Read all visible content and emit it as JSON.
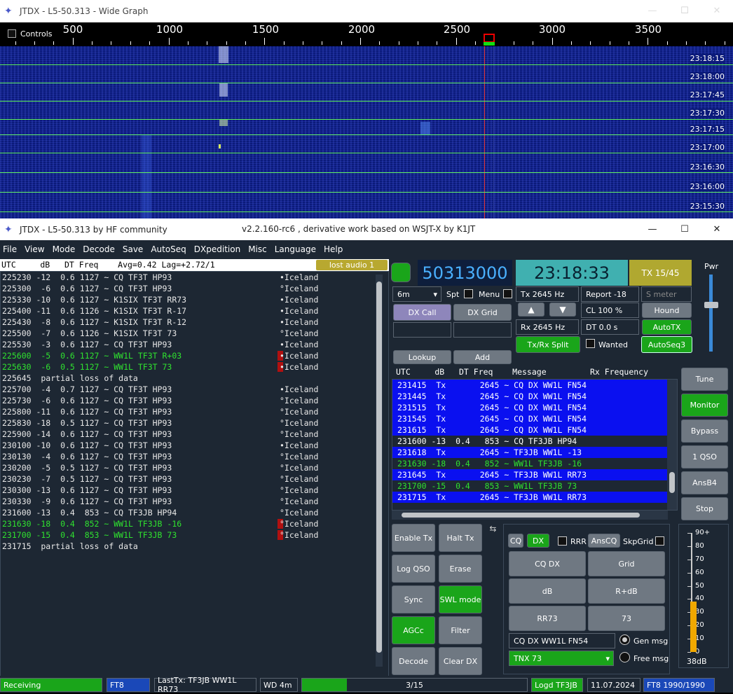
{
  "wide_graph": {
    "title": "JTDX - L5-50.313 - Wide Graph",
    "controls_label": "Controls",
    "scale_labels": [
      "500",
      "1000",
      "1500",
      "2000",
      "2500",
      "3000",
      "3500"
    ],
    "times": [
      "23:18:15",
      "23:18:00",
      "23:17:45",
      "23:17:30",
      "23:17:15",
      "23:17:00",
      "23:16:30",
      "23:16:00",
      "23:15:30"
    ],
    "band": "6m"
  },
  "main": {
    "title": "JTDX - L5-50.313  by HF community",
    "subtitle": "v2.2.160-rc6 , derivative work based on WSJT-X by K1JT",
    "menu": [
      "File",
      "View",
      "Mode",
      "Decode",
      "Save",
      "AutoSeq",
      "DXpedition",
      "Misc",
      "Language",
      "Help"
    ],
    "left_header": "UTC     dB   DT Freq    Avg=0.42 Lag=+2.72/1",
    "lost_audio": "lost audio 1",
    "decodes": [
      {
        "t": "225230 -12  0.6 1127 ~ CQ TF3T HP93",
        "c": "•Iceland",
        "g": false,
        "m": false
      },
      {
        "t": "225300  -6  0.6 1127 ~ CQ TF3T HP93",
        "c": "°Iceland",
        "g": false,
        "m": false
      },
      {
        "t": "225330 -10  0.6 1127 ~ K1SIX TF3T RR73",
        "c": "•Iceland",
        "g": false,
        "m": false
      },
      {
        "t": "225400 -11  0.6 1126 ~ K1SIX TF3T R-17",
        "c": "•Iceland",
        "g": false,
        "m": false
      },
      {
        "t": "225430  -8  0.6 1127 ~ K1SIX TF3T R-12",
        "c": "•Iceland",
        "g": false,
        "m": false
      },
      {
        "t": "225500  -7  0.6 1126 ~ K1SIX TF3T 73",
        "c": "°Iceland",
        "g": false,
        "m": false
      },
      {
        "t": "225530  -3  0.6 1127 ~ CQ TF3T HP93",
        "c": "•Iceland",
        "g": false,
        "m": false
      },
      {
        "t": "225600  -5  0.6 1127 ~ WW1L TF3T R+03",
        "c": "•Iceland",
        "g": true,
        "m": true
      },
      {
        "t": "225630  -6  0.5 1127 ~ WW1L TF3T 73",
        "c": "•Iceland",
        "g": true,
        "m": true
      },
      {
        "t": "225645  partial loss of data",
        "c": "",
        "g": false,
        "m": false
      },
      {
        "t": "225700  -4  0.7 1127 ~ CQ TF3T HP93",
        "c": "•Iceland",
        "g": false,
        "m": false
      },
      {
        "t": "225730  -6  0.6 1127 ~ CQ TF3T HP93",
        "c": "°Iceland",
        "g": false,
        "m": false
      },
      {
        "t": "225800 -11  0.6 1127 ~ CQ TF3T HP93",
        "c": "°Iceland",
        "g": false,
        "m": false
      },
      {
        "t": "225830 -18  0.5 1127 ~ CQ TF3T HP93",
        "c": "°Iceland",
        "g": false,
        "m": false
      },
      {
        "t": "225900 -14  0.6 1127 ~ CQ TF3T HP93",
        "c": "°Iceland",
        "g": false,
        "m": false
      },
      {
        "t": "230100 -10  0.6 1127 ~ CQ TF3T HP93",
        "c": "•Iceland",
        "g": false,
        "m": false
      },
      {
        "t": "230130  -4  0.6 1127 ~ CQ TF3T HP93",
        "c": "°Iceland",
        "g": false,
        "m": false
      },
      {
        "t": "230200  -5  0.5 1127 ~ CQ TF3T HP93",
        "c": "°Iceland",
        "g": false,
        "m": false
      },
      {
        "t": "230230  -7  0.5 1127 ~ CQ TF3T HP93",
        "c": "°Iceland",
        "g": false,
        "m": false
      },
      {
        "t": "230300 -13  0.6 1127 ~ CQ TF3T HP93",
        "c": "°Iceland",
        "g": false,
        "m": false
      },
      {
        "t": "230330  -9  0.6 1127 ~ CQ TF3T HP93",
        "c": "°Iceland",
        "g": false,
        "m": false
      },
      {
        "t": "231600 -13  0.4  853 ~ CQ TF3JB HP94",
        "c": "°Iceland",
        "g": false,
        "m": false
      },
      {
        "t": "231630 -18  0.4  852 ~ WW1L TF3JB -16",
        "c": "°Iceland",
        "g": true,
        "m": true
      },
      {
        "t": "231700 -15  0.4  853 ~ WW1L TF3JB 73",
        "c": "°Iceland",
        "g": true,
        "m": true
      },
      {
        "t": "231715  partial loss of data",
        "c": "",
        "g": false,
        "m": false
      }
    ],
    "dial_freq": "50313000",
    "clock": "23:18:33",
    "tx_phase": "TX 15/45",
    "pwr_label": "Pwr",
    "band_select": "6m",
    "spt": "Spt",
    "menu_chk": "Menu",
    "tx_freq": "Tx  2645 Hz",
    "rx_freq": "Rx  2645 Hz",
    "report": "Report -18",
    "smeter": "S meter",
    "cl": "CL  100 %",
    "dt": "DT 0.0 s",
    "buttons": {
      "dx_call": "DX Call",
      "dx_grid": "DX Grid",
      "lookup": "Lookup",
      "add": "Add",
      "hound": "Hound",
      "autotx": "AutoTX",
      "txrx_split": "Tx/Rx Split",
      "wanted": "Wanted",
      "autoseq3": "AutoSeq3",
      "tune": "Tune",
      "monitor": "Monitor",
      "bypass": "Bypass",
      "one_qso": "1 QSO",
      "ansb4": "AnsB4",
      "stop": "Stop",
      "enable_tx": "Enable Tx",
      "halt_tx": "Halt Tx",
      "log_qso": "Log QSO",
      "erase": "Erase",
      "sync": "Sync",
      "swl": "SWL mode",
      "agcc": "AGCc",
      "filter": "Filter",
      "decode": "Decode",
      "clear_dx": "Clear DX"
    },
    "right_header": "UTC     dB   DT Freq    Message         Rx Frequency",
    "rx_rows": [
      {
        "t": "231415  Tx       2645 ~ CQ DX WW1L FN54",
        "k": "tx"
      },
      {
        "t": "231445  Tx       2645 ~ CQ DX WW1L FN54",
        "k": "tx"
      },
      {
        "t": "231515  Tx       2645 ~ CQ DX WW1L FN54",
        "k": "tx"
      },
      {
        "t": "231545  Tx       2645 ~ CQ DX WW1L FN54",
        "k": "tx"
      },
      {
        "t": "231615  Tx       2645 ~ CQ DX WW1L FN54",
        "k": "tx"
      },
      {
        "t": "231600 -13  0.4   853 ~ CQ TF3JB HP94",
        "k": "n"
      },
      {
        "t": "231618  Tx       2645 ~ TF3JB WW1L -13",
        "k": "tx"
      },
      {
        "t": "231630 -18  0.4   852 ~ WW1L TF3JB -16",
        "k": "g"
      },
      {
        "t": "231645  Tx       2645 ~ TF3JB WW1L RR73",
        "k": "tx"
      },
      {
        "t": "231700 -15  0.4   853 ~ WW1L TF3JB 73",
        "k": "g"
      },
      {
        "t": "231715  Tx       2645 ~ TF3JB WW1L RR73",
        "k": "tx"
      }
    ],
    "msg": {
      "cq": "CQ",
      "dx": "DX",
      "rrr": "RRR",
      "anscq": "AnsCQ",
      "skpgrid": "SkpGrid",
      "cqdx": "CQ DX",
      "grid": "Grid",
      "db": "dB",
      "rdb": "R+dB",
      "rr73": "RR73",
      "m73": "73",
      "gen_text": "CQ DX WW1L FN54",
      "free_text": "TNX 73",
      "gen_msg": "Gen msg",
      "free_msg": "Free msg"
    },
    "meter": {
      "labels": [
        "90+",
        "80",
        "70",
        "60",
        "50",
        "40",
        "30",
        "20",
        "10",
        "0"
      ],
      "value": "38dB",
      "level_db": 38
    },
    "status": {
      "receiving": "Receiving",
      "mode": "FT8",
      "lasttx": "LastTx: TF3JB WW1L RR73",
      "wd": "WD 4m",
      "progress": "3/15",
      "progress_fraction": 0.2,
      "logd": "Logd TF3JB",
      "date": "11.07.2024",
      "ft8count": "FT8  1990/1990"
    }
  }
}
